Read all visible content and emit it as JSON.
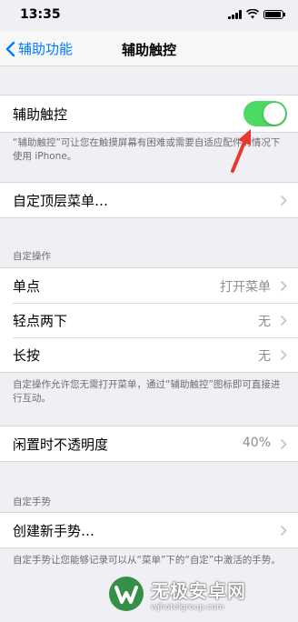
{
  "status": {
    "time": "13:35"
  },
  "nav": {
    "back_label": "辅助功能",
    "title": "辅助触控"
  },
  "assistive_touch": {
    "label": "辅助触控",
    "enabled": true,
    "footer": "“辅助触控”可让您在触摸屏幕有困难或需要自适应配件的情况下使用 iPhone。"
  },
  "top_menu": {
    "label": "自定顶层菜单…"
  },
  "custom_actions": {
    "header": "自定操作",
    "rows": [
      {
        "label": "单点",
        "value": "打开菜单"
      },
      {
        "label": "轻点两下",
        "value": "无"
      },
      {
        "label": "长按",
        "value": "无"
      }
    ],
    "footer": "自定操作允许您无需打开菜单，通过“辅助触控”图标即可直接进行互动。"
  },
  "idle_opacity": {
    "label": "闲置时不透明度",
    "value": "40%"
  },
  "custom_gestures": {
    "header": "自定手势",
    "create_label": "创建新手势…",
    "footer": "自定手势让您能够记录可以从“菜单”下的“自定”中激活的手势。"
  },
  "watermark": {
    "title": "无极安卓网",
    "url": "wjhotelgroup.com"
  },
  "colors": {
    "accent": "#007aff",
    "toggle_on": "#4cd964",
    "arrow": "#e8392d"
  }
}
